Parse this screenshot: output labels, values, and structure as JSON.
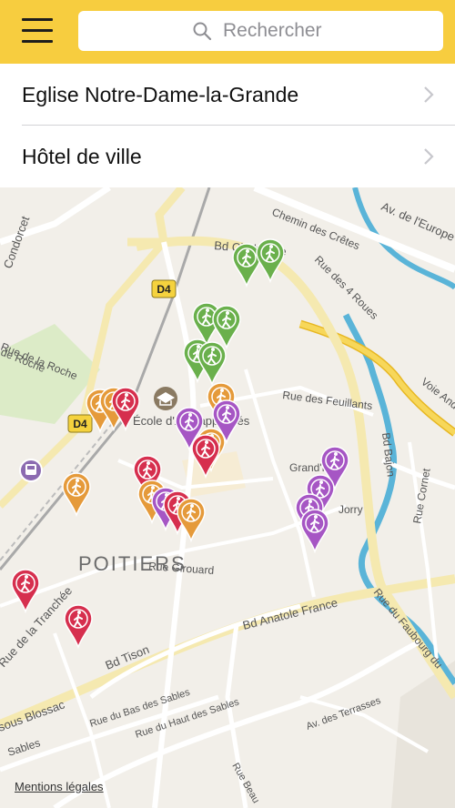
{
  "search": {
    "placeholder": "Rechercher"
  },
  "results": [
    {
      "label": "Eglise Notre-Dame-la-Grande"
    },
    {
      "label": "Hôtel de ville"
    }
  ],
  "map": {
    "city_label": "POITIERS",
    "roads": [
      {
        "name": "Av. de l'Europe"
      },
      {
        "name": "Chemin des Crêtes"
      },
      {
        "name": "Rue des 4 Roues"
      },
      {
        "name": "Bd Chabanne"
      },
      {
        "name": "Rue des Feuillants"
      },
      {
        "name": "Bd Bajon"
      },
      {
        "name": "Voie André"
      },
      {
        "name": "Grand'Rue"
      },
      {
        "name": "Rue Cornet"
      },
      {
        "name": "Rue Girouard"
      },
      {
        "name": "Bd Anatole France"
      },
      {
        "name": "Rue du Faubourg du"
      },
      {
        "name": "Bd Tison"
      },
      {
        "name": "Rue de la Tranchée"
      },
      {
        "name": "Rue du Bas des Sables"
      },
      {
        "name": "Rue du Haut des Sables"
      },
      {
        "name": "Av. des Terrasses"
      },
      {
        "name": "sous Blossac"
      },
      {
        "name": "Sables"
      },
      {
        "name": "Rue Beau"
      },
      {
        "name": "Rue de la Roche"
      },
      {
        "name": "Condorcet"
      }
    ],
    "partial_labels": [
      "École d'Arts appliqués",
      "Jorry",
      "de Roche"
    ],
    "route_badges": [
      "D4",
      "D4"
    ],
    "colors": {
      "green": "#6ab04c",
      "orange": "#e59a3a",
      "red": "#d62f4e",
      "purple": "#a656c4",
      "park": "#cfe3b4",
      "water": "#5ab4d8",
      "highway": "#f3c93a"
    }
  },
  "footer": {
    "legal": "Mentions légales"
  }
}
